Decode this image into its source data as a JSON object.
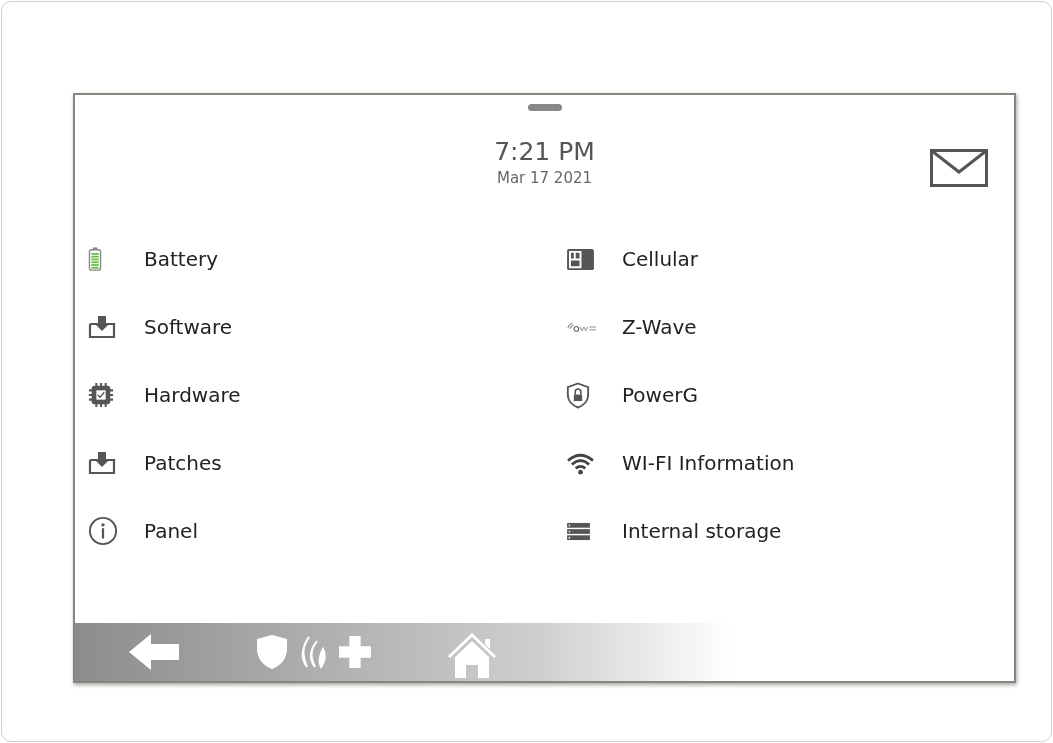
{
  "header": {
    "time": "7:21 PM",
    "date": "Mar 17 2021"
  },
  "menu": {
    "left": [
      {
        "label": "Battery"
      },
      {
        "label": "Software"
      },
      {
        "label": "Hardware"
      },
      {
        "label": "Patches"
      },
      {
        "label": "Panel"
      }
    ],
    "right": [
      {
        "label": "Cellular"
      },
      {
        "label": "Z-Wave"
      },
      {
        "label": "PowerG"
      },
      {
        "label": "WI-FI Information"
      },
      {
        "label": "Internal storage"
      }
    ]
  }
}
